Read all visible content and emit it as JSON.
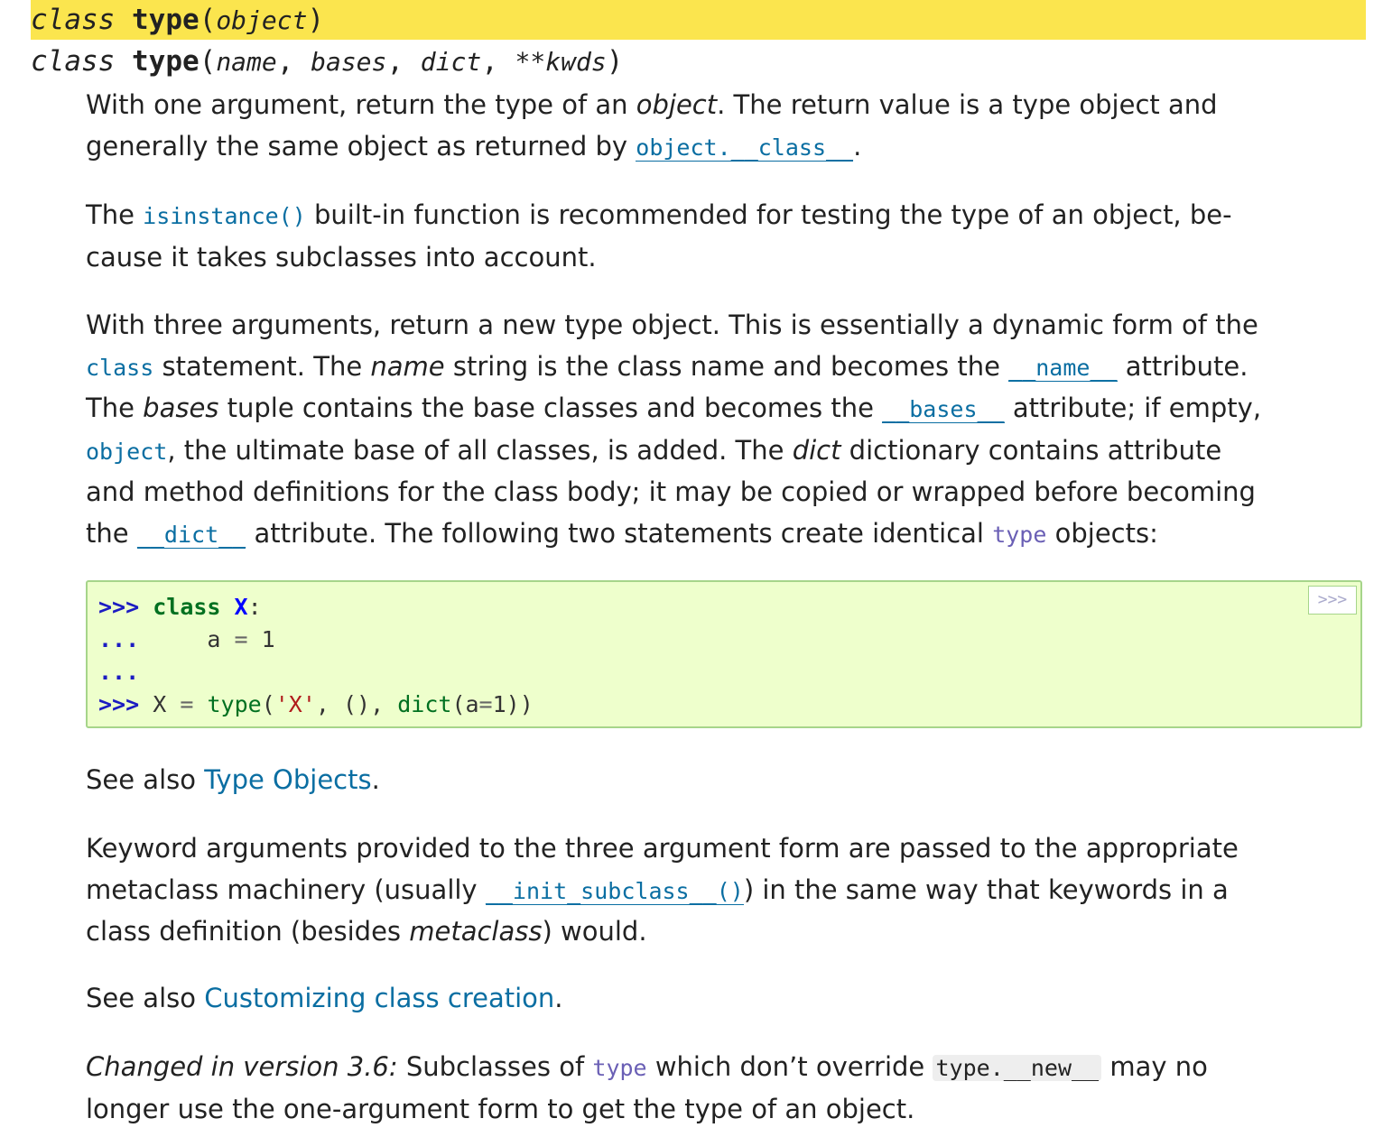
{
  "signature1": {
    "keyword": "class",
    "name": "type",
    "open_paren": "(",
    "params": "object",
    "close_paren": ")"
  },
  "signature2": {
    "keyword": "class",
    "name": "type",
    "open_paren": "(",
    "p1": "name",
    "comma1": ",",
    "p2": "bases",
    "comma2": ",",
    "p3": "dict",
    "comma3": ",",
    "p4": "**kwds",
    "close_paren": ")"
  },
  "para1": {
    "t1": "With one argument, return the type of an ",
    "em1": "object",
    "t2": ". The return value is a type object and",
    "t3": "generally the same object as returned by ",
    "ref1": "object.__class__",
    "t4": "."
  },
  "para2": {
    "t1": "The ",
    "ref1": "isinstance()",
    "t2": " built-in function is recommended for testing the type of an object, be-",
    "t3": "cause it takes subclasses into account."
  },
  "para3": {
    "l1": "With three arguments, return a new type object. This is essentially a dynamic form of the",
    "l2_ref": "class",
    "l2_a": " statement. The ",
    "l2_em": "name",
    "l2_b": " string is the class name and becomes the ",
    "l2_ref2": "__name__",
    "l2_c": " attribute.",
    "l3_a": "The ",
    "l3_em": "bases",
    "l3_b": " tuple contains the base classes and becomes the ",
    "l3_ref": "__bases__",
    "l3_c": " attribute; if empty,",
    "l4_ref": "object",
    "l4_a": ", the ultimate base of all classes, is added. The ",
    "l4_em": "dict",
    "l4_b": " dictionary contains attribute",
    "l5": "and method definitions for the class body; it may be copied or wrapped before becoming",
    "l6_a": "the ",
    "l6_ref": "__dict__",
    "l6_b": " attribute. The following two statements create identical ",
    "l6_ref2": "type",
    "l6_c": " objects:"
  },
  "code": {
    "copy_button": ">>>",
    "line1_prompt": ">>> ",
    "line1_kw": "class",
    "line1_name": "X",
    "line1_colon": ":",
    "line2_prompt": "...",
    "line2_var": "a",
    "line2_op": "=",
    "line2_num": "1",
    "line3_prompt": "...",
    "line4_prompt": ">>> ",
    "line4_var": "X",
    "line4_op": "=",
    "line4_fn": "type",
    "line4_p1": "(",
    "line4_str": "'X'",
    "line4_mid": ", (), ",
    "line4_fn2": "dict",
    "line4_p2": "(a",
    "line4_eq": "=",
    "line4_num": "1",
    "line4_end": "))"
  },
  "see_also1": {
    "prefix": "See also ",
    "link": "Type Objects",
    "suffix": "."
  },
  "para4": {
    "l1": "Keyword arguments provided to the three argument form are passed to the appropriate",
    "l2_a": "metaclass machinery (usually ",
    "l2_ref": "__init_subclass__()",
    "l2_b": ") in the same way that keywords in a",
    "l3_a": "class definition (besides ",
    "l3_em": "metaclass",
    "l3_b": ") would."
  },
  "see_also2": {
    "prefix": "See also ",
    "link": "Customizing class creation",
    "suffix": "."
  },
  "changed": {
    "em": "Changed in version 3.6:",
    "a": " Subclasses of ",
    "ref": "type",
    "b": " which don’t override ",
    "lit": "type.__new__",
    "c": " may no",
    "l2": "longer use the one-argument form to get the type of an object."
  }
}
